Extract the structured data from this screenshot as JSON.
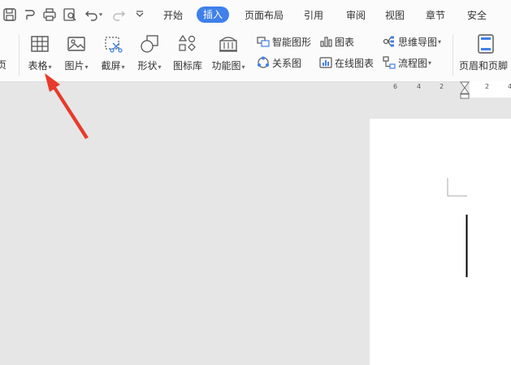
{
  "tabs": [
    "开始",
    "插入",
    "页面布局",
    "引用",
    "审阅",
    "视图",
    "章节",
    "安全"
  ],
  "active_tab": "插入",
  "ribbon": {
    "left_cut_label": "页",
    "table": "表格",
    "picture": "图片",
    "screenshot": "截屏",
    "shape": "形状",
    "icon_lib": "图标库",
    "func_chart": "功能图",
    "smart_shape": "智能图形",
    "chart": "图表",
    "mind_map": "思维导图",
    "relation_chart": "关系图",
    "online_chart": "在线图表",
    "flowchart": "流程图",
    "header_footer": "页眉和页脚"
  },
  "ruler_ticks": [
    "6",
    "4",
    "2",
    "2",
    "4"
  ],
  "colors": {
    "active_tab_bg": "#3f80ea",
    "arrow": "#e83a2b"
  }
}
